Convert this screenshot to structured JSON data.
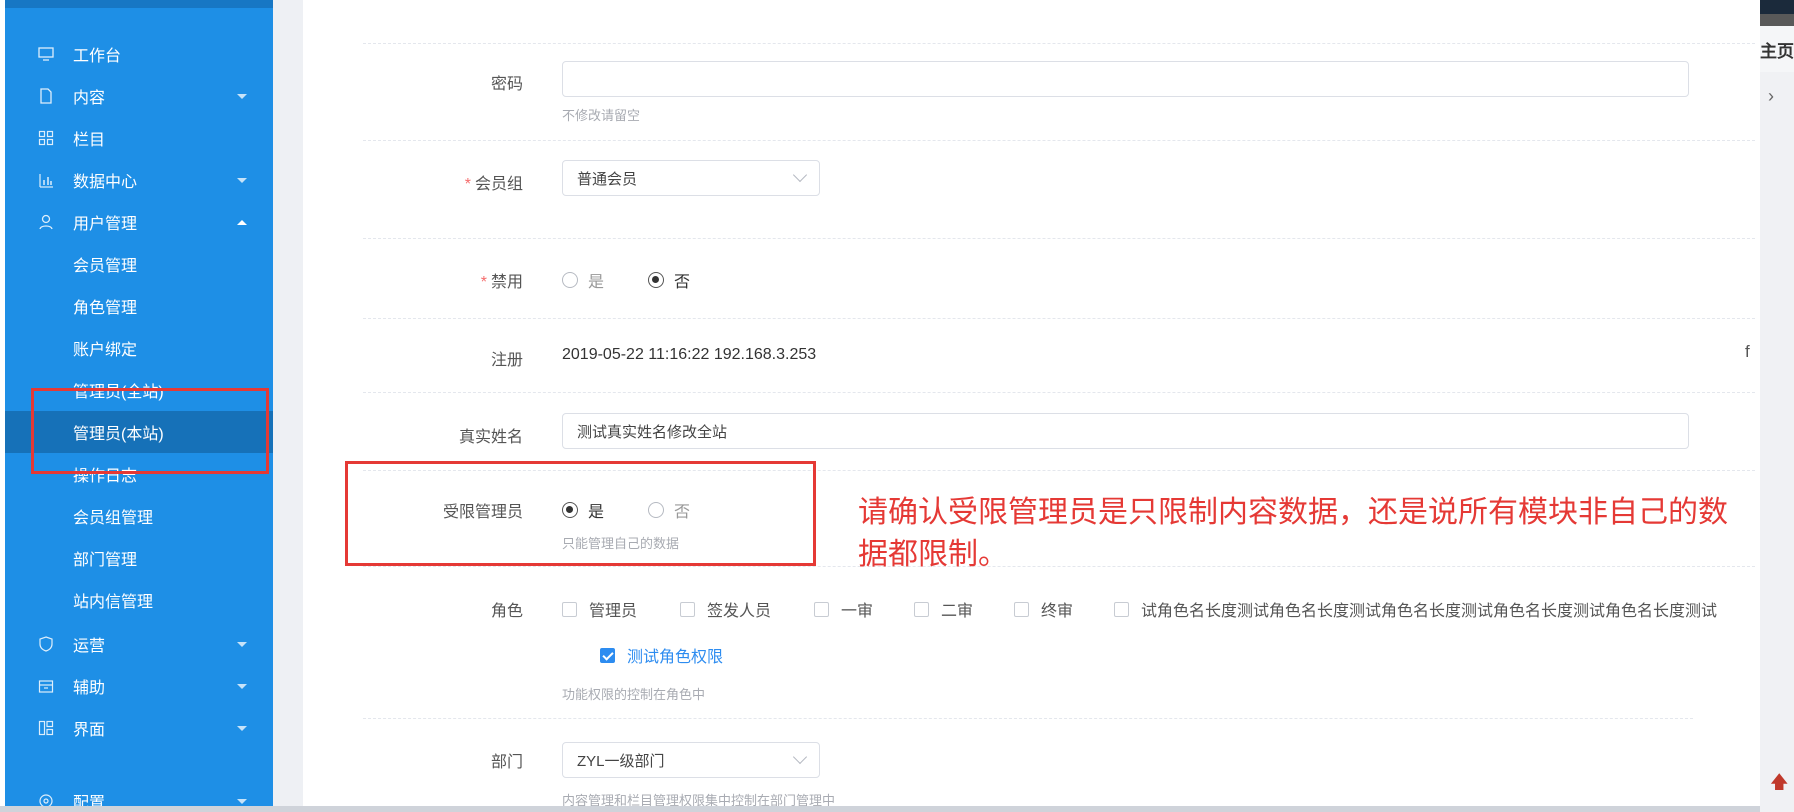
{
  "sidebar": {
    "items": [
      {
        "label": "工作台",
        "icon": "monitor-icon",
        "arrow": "none"
      },
      {
        "label": "内容",
        "icon": "document-icon",
        "arrow": "down"
      },
      {
        "label": "栏目",
        "icon": "grid-icon",
        "arrow": "none"
      },
      {
        "label": "数据中心",
        "icon": "bar-chart-icon",
        "arrow": "down"
      },
      {
        "label": "用户管理",
        "icon": "user-icon",
        "arrow": "up"
      }
    ],
    "sub_items": [
      {
        "label": "会员管理"
      },
      {
        "label": "角色管理"
      },
      {
        "label": "账户绑定"
      },
      {
        "label": "管理员(全站)"
      },
      {
        "label": "管理员(本站)"
      },
      {
        "label": "操作日志"
      },
      {
        "label": "会员组管理"
      },
      {
        "label": "部门管理"
      },
      {
        "label": "站内信管理"
      }
    ],
    "bottom_items": [
      {
        "label": "运营",
        "icon": "shield-icon"
      },
      {
        "label": "辅助",
        "icon": "box-icon"
      },
      {
        "label": "界面",
        "icon": "layout-icon"
      },
      {
        "label": "配置",
        "icon": "settings-icon"
      }
    ]
  },
  "form": {
    "password": {
      "label": "密码",
      "value": "",
      "hint": "不修改请留空"
    },
    "member_group": {
      "label": "会员组",
      "value": "普通会员"
    },
    "disabled": {
      "label": "禁用",
      "options": [
        "是",
        "否"
      ],
      "selected": "否"
    },
    "register": {
      "label": "注册",
      "value": "2019-05-22 11:16:22 192.168.3.253"
    },
    "real_name": {
      "label": "真实姓名",
      "value": "测试真实姓名修改全站"
    },
    "restricted_admin": {
      "label": "受限管理员",
      "options": [
        "是",
        "否"
      ],
      "selected": "是",
      "hint": "只能管理自己的数据"
    },
    "roles": {
      "label": "角色",
      "items": [
        "管理员",
        "签发人员",
        "一审",
        "二审",
        "终审",
        "试角色名长度测试角色名长度测试角色名长度测试角色名长度测试角色名长度测试"
      ],
      "checked_item": "测试角色权限",
      "hint": "功能权限的控制在角色中"
    },
    "department": {
      "label": "部门",
      "value": "ZYL一级部门",
      "hint": "内容管理和栏目管理权限集中控制在部门管理中"
    }
  },
  "annotation": {
    "text": "请确认受限管理员是只限制内容数据，还是说所有模块非自己的数据都限制。",
    "color": "#e53935"
  },
  "right_panel": {
    "tab_label": "主页"
  },
  "colors": {
    "sidebar": "#1e8fe6",
    "sidebar_active": "#1671b8",
    "highlight": "#e53935",
    "accent": "#2d8cf0"
  }
}
